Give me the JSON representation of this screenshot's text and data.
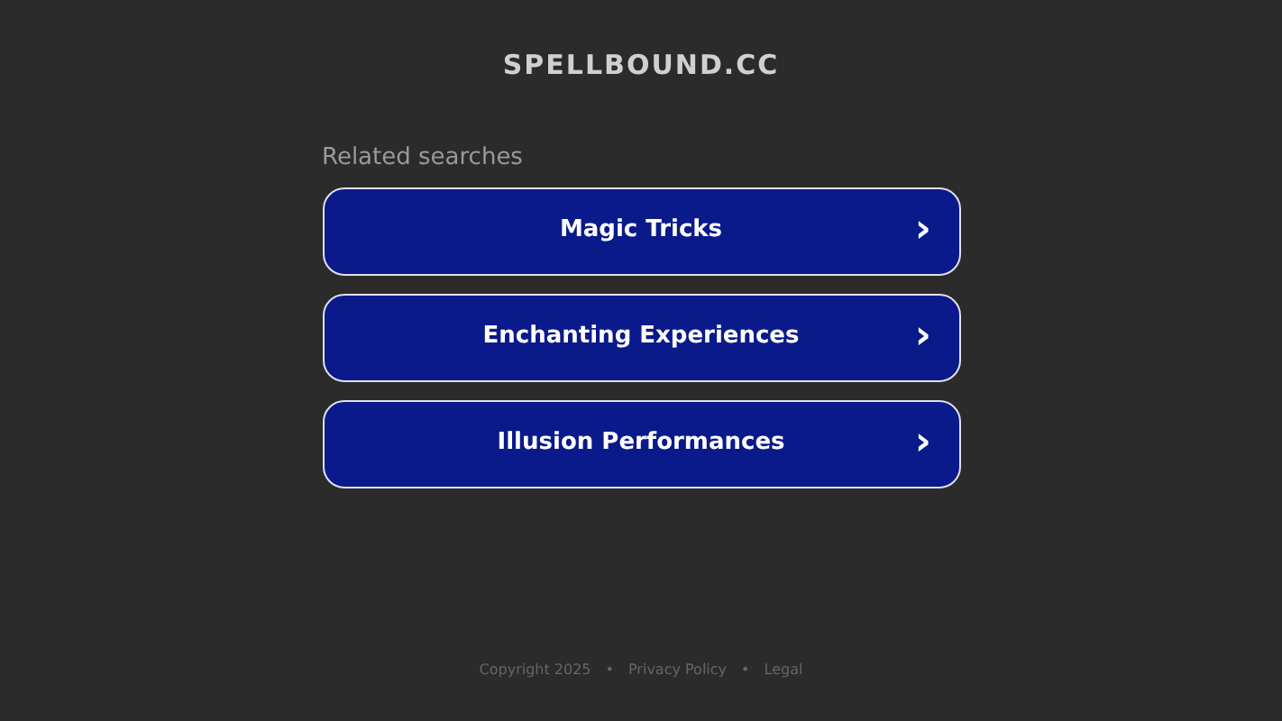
{
  "site_title": "SPELLBOUND.CC",
  "heading": "Related searches",
  "searches": [
    {
      "label": "Magic Tricks",
      "arrow": "›"
    },
    {
      "label": "Enchanting Experiences",
      "arrow": "›"
    },
    {
      "label": "Illusion Performances",
      "arrow": "›"
    }
  ],
  "footer": {
    "copyright": "Copyright 2025",
    "separator": "•",
    "links": [
      "Privacy Policy",
      "Legal"
    ]
  }
}
